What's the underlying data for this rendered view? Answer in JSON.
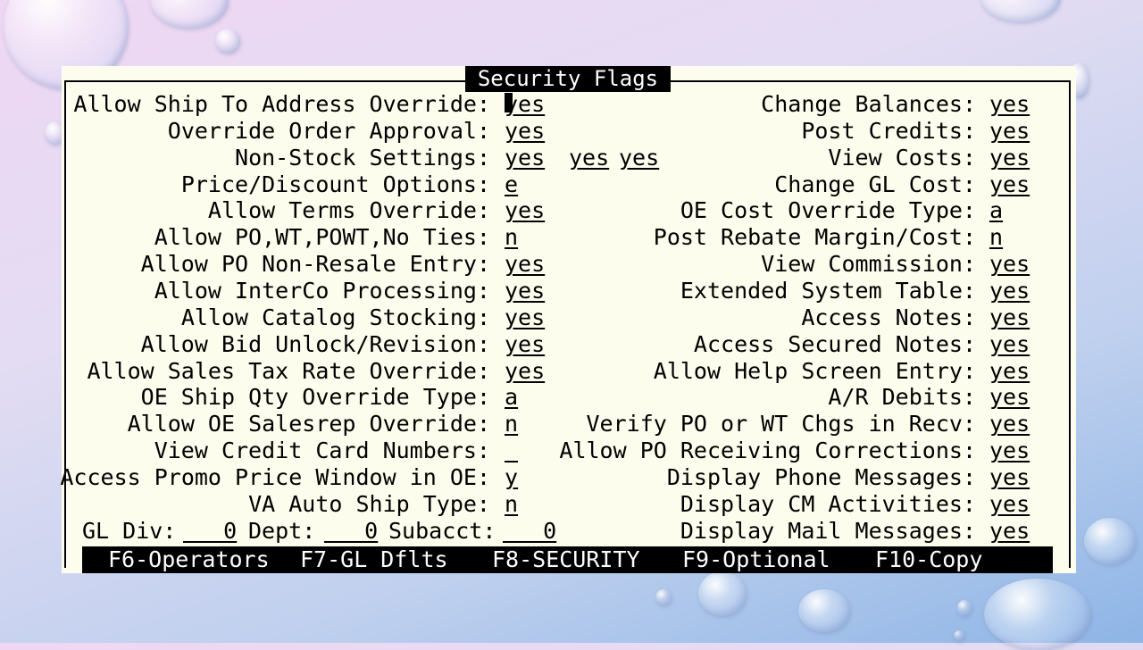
{
  "title": "Security Flags",
  "left_fields": [
    {
      "label": "Allow Ship To Address Override:",
      "values": [
        "yes"
      ]
    },
    {
      "label": "Override Order Approval:",
      "values": [
        "yes"
      ]
    },
    {
      "label": "Non-Stock Settings:",
      "values": [
        "yes",
        "yes",
        "yes"
      ]
    },
    {
      "label": "Price/Discount Options:",
      "values": [
        "e"
      ]
    },
    {
      "label": "Allow Terms Override:",
      "values": [
        "yes"
      ]
    },
    {
      "label": "Allow PO,WT,POWT,No Ties:",
      "values": [
        "n"
      ]
    },
    {
      "label": "Allow PO Non-Resale Entry:",
      "values": [
        "yes"
      ]
    },
    {
      "label": "Allow InterCo Processing:",
      "values": [
        "yes"
      ]
    },
    {
      "label": "Allow Catalog Stocking:",
      "values": [
        "yes"
      ]
    },
    {
      "label": "Allow Bid Unlock/Revision:",
      "values": [
        "yes"
      ]
    },
    {
      "label": "Allow Sales Tax Rate Override:",
      "values": [
        "yes"
      ]
    },
    {
      "label": "OE Ship Qty Override Type:",
      "values": [
        "a"
      ]
    },
    {
      "label": "Allow OE Salesrep Override:",
      "values": [
        "n"
      ]
    },
    {
      "label": "View Credit Card Numbers:",
      "values": [
        " "
      ]
    },
    {
      "label": "Access Promo Price Window in OE:",
      "values": [
        "y"
      ]
    },
    {
      "label": "VA Auto Ship Type:",
      "values": [
        "n"
      ]
    }
  ],
  "gl_row": {
    "div_label": "GL Div:",
    "div_value": "   0",
    "dept_label": "Dept:",
    "dept_value": "   0",
    "subacct_label": "Subacct:",
    "subacct_value": "   0"
  },
  "right_fields": [
    {
      "label": "Change Balances:",
      "value": "yes"
    },
    {
      "label": "Post Credits:",
      "value": "yes"
    },
    {
      "label": "View Costs:",
      "value": "yes"
    },
    {
      "label": "Change GL Cost:",
      "value": "yes"
    },
    {
      "label": "OE Cost Override Type:",
      "value": "a"
    },
    {
      "label": "Post Rebate Margin/Cost:",
      "value": "n"
    },
    {
      "label": "View Commission:",
      "value": "yes"
    },
    {
      "label": "Extended System Table:",
      "value": "yes"
    },
    {
      "label": "Access Notes:",
      "value": "yes"
    },
    {
      "label": "Access Secured Notes:",
      "value": "yes"
    },
    {
      "label": "Allow Help Screen Entry:",
      "value": "yes"
    },
    {
      "label": "A/R Debits:",
      "value": "yes"
    },
    {
      "label": "Verify PO or WT Chgs in Recv:",
      "value": "yes"
    },
    {
      "label": "Allow PO Receiving Corrections:",
      "value": "yes"
    },
    {
      "label": "Display Phone Messages:",
      "value": "yes"
    },
    {
      "label": "Display CM Activities:",
      "value": "yes"
    },
    {
      "label": "Display Mail Messages:",
      "value": "yes"
    }
  ],
  "function_keys": [
    "F6-Operators",
    "F7-GL Dflts",
    "F8-SECURITY",
    "F9-Optional",
    "F10-Copy"
  ],
  "colors": {
    "screen_bg": "#fdfdee",
    "text": "#000000",
    "bar_bg": "#000000",
    "bar_text": "#ffffff"
  }
}
